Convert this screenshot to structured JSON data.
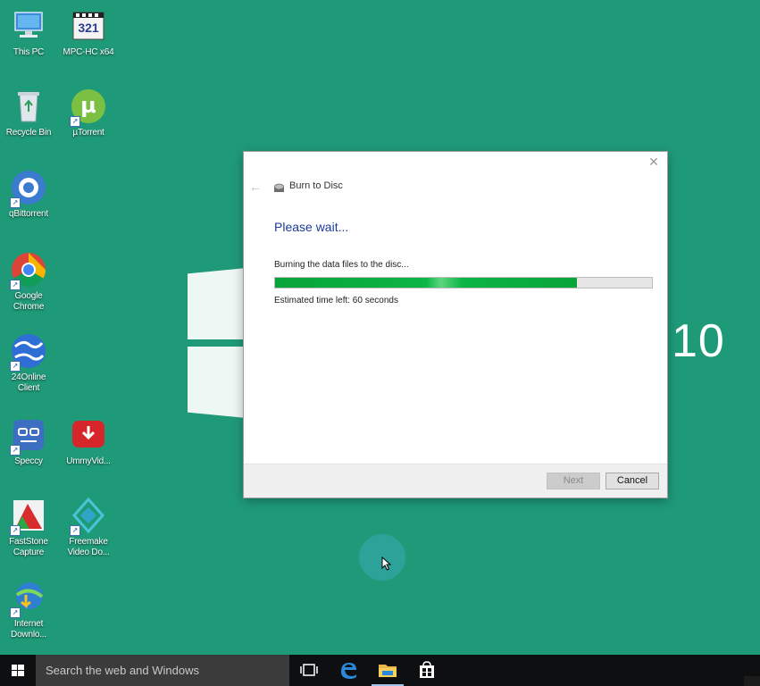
{
  "wallpaper": {
    "text": "10",
    "background": "#1f9a79"
  },
  "desktop_icons": [
    {
      "label": "This PC",
      "icon": "this-pc-icon"
    },
    {
      "label": "MPC-HC x64",
      "icon": "mpc-hc-icon",
      "badge": "321"
    },
    {
      "label": "Recycle Bin",
      "icon": "recycle-bin-icon"
    },
    {
      "label": "µTorrent",
      "icon": "utorrent-icon",
      "badge": "µ"
    },
    {
      "label": "qBittorrent",
      "icon": "qbittorrent-icon"
    },
    {
      "label": "Google Chrome",
      "icon": "chrome-icon"
    },
    {
      "label": "24Online Client",
      "icon": "24online-icon"
    },
    {
      "label": "Speccy",
      "icon": "speccy-icon"
    },
    {
      "label": "UmmyVid...",
      "icon": "ummy-video-icon"
    },
    {
      "label": "FastStone Capture",
      "icon": "faststone-icon"
    },
    {
      "label": "Freemake Video Do...",
      "icon": "freemake-icon"
    },
    {
      "label": "Internet Downlo...",
      "icon": "idm-icon"
    }
  ],
  "dialog": {
    "title": "Burn to Disc",
    "heading": "Please wait...",
    "status": "Burning the data files to the disc...",
    "progress": 0.8,
    "eta": "Estimated time left: 60 seconds",
    "next_label": "Next",
    "cancel_label": "Cancel",
    "close_glyph": "✕",
    "back_glyph": "←"
  },
  "taskbar": {
    "search_placeholder": "Search the web and Windows",
    "accent": "#9fc4e8"
  }
}
